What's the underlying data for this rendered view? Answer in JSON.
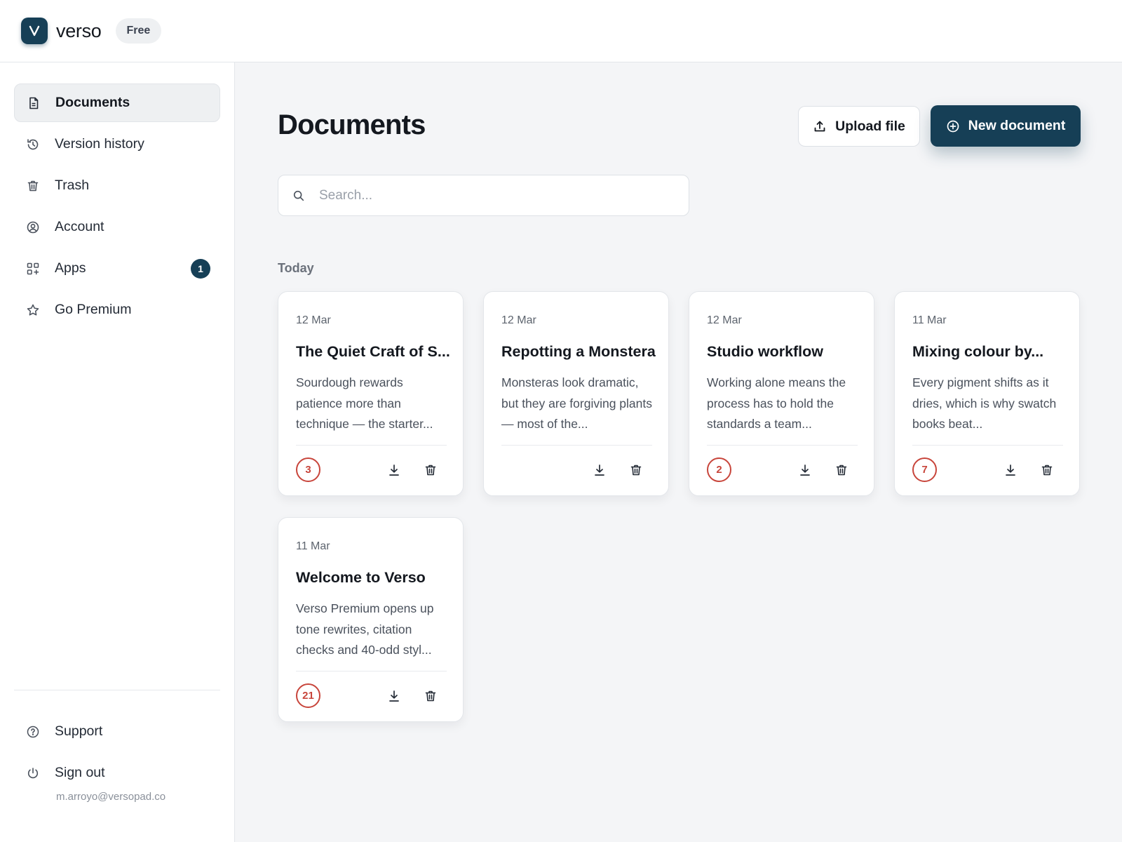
{
  "app": {
    "brand": "verso",
    "plan": "Free",
    "logo_letter": "V",
    "accent": "#163f56",
    "count_color": "#c8453b"
  },
  "sidebar": {
    "items": [
      {
        "label": "Documents",
        "icon": "document-icon",
        "active": true
      },
      {
        "label": "Version history",
        "icon": "history-icon"
      },
      {
        "label": "Trash",
        "icon": "trash-icon"
      },
      {
        "label": "Account",
        "icon": "user-circle-icon"
      },
      {
        "label": "Apps",
        "icon": "apps-grid-icon",
        "badge": "1"
      },
      {
        "label": "Go Premium",
        "icon": "star-icon"
      }
    ],
    "footer": [
      {
        "label": "Support",
        "icon": "help-circle-icon"
      },
      {
        "label": "Sign out",
        "icon": "power-icon"
      }
    ],
    "user_email": "m.arroyo@versopad.co"
  },
  "main": {
    "title": "Documents",
    "upload_label": "Upload file",
    "new_label": "New document",
    "search_placeholder": "Search...",
    "section_label": "Today",
    "cards": [
      {
        "date": "12 Mar",
        "title": "The Quiet Craft of S...",
        "excerpt": "Sourdough rewards patience more than technique — the starter...",
        "count": "3"
      },
      {
        "date": "12 Mar",
        "title": "Repotting a Monstera",
        "excerpt": "Monsteras look dramatic, but they are forgiving plants — most of the...",
        "count": ""
      },
      {
        "date": "12 Mar",
        "title": "Studio workflow",
        "excerpt": "Working alone means the process has to hold the standards a team...",
        "count": "2"
      },
      {
        "date": "11 Mar",
        "title": "Mixing colour by...",
        "excerpt": "Every pigment shifts as it dries, which is why swatch books beat...",
        "count": "7"
      },
      {
        "date": "11 Mar",
        "title": "Welcome to Verso",
        "excerpt": "Verso Premium opens up tone rewrites, citation checks and 40-odd styl...",
        "count": "21"
      }
    ]
  }
}
